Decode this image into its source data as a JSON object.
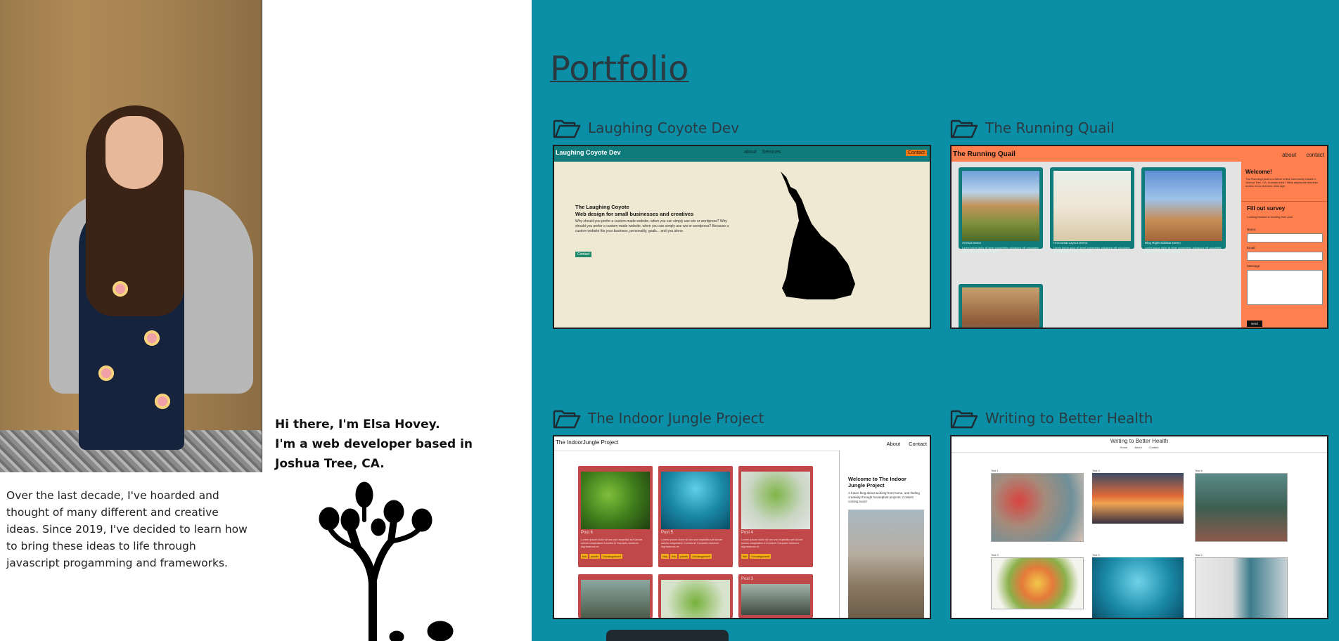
{
  "intro": {
    "greeting": "Hi there, I'm Elsa Hovey.",
    "role": "I'm a web developer based in Joshua Tree, CA.",
    "bio": "Over the last decade, I've hoarded and thought of many different and creative ideas. Since 2019, I've decided to learn how to bring these ideas to life through javascript progamming and frameworks."
  },
  "portfolio": {
    "title": "Portfolio",
    "projects": [
      {
        "title": "Laughing Coyote Dev",
        "shot": {
          "brand": "Laughing Coyote Dev",
          "nav": [
            "about",
            "Services"
          ],
          "cta": "Contact",
          "heading": "The Laughing Coyote",
          "subheading": "Web design for small businesses and creatives",
          "text": "Why should you prefer a custom-made website, when you can simply use wix or wordpress? Why should you prefer a custom-made website, when you can simply use wix or wordpress? Because a custom website fits your business, personality, goals... and you alone.",
          "button": "Contact"
        }
      },
      {
        "title": "The Running Quail",
        "shot": {
          "brand": "The Running Quail",
          "nav": [
            "about",
            "contact"
          ],
          "cards": [
            "Animal Demo",
            "Horizontal Layout Demo",
            "Blog Right Sidebar Demo"
          ],
          "card_text": "Lorem ipsum dolor sit amet consectetur adipiscing elit voluptates saepe incidunt autem commodi.",
          "welcome_title": "Welcome!",
          "welcome_text": "The Running Quail is a future online community based in Joshua Tree, CA. Animals exist? Hilde adipiscate timeless, doxtes recon dolorem vitae agit.",
          "survey_title": "Fill out survey",
          "survey_text": "Looking forward to hearing from you!",
          "labels": [
            "Name:",
            "Email:",
            "Message:"
          ],
          "send": "send"
        }
      },
      {
        "title": "The Indoor Jungle Project",
        "shot": {
          "brand": "The IndoorJungle Project",
          "nav": [
            "About",
            "Contact"
          ],
          "posts": [
            {
              "title": "Post 6",
              "tags": [
                "fish",
                "plants",
                "Uncategorized"
              ]
            },
            {
              "title": "Post 5",
              "tags": [
                "clay",
                "fish",
                "plants",
                "Uncategorized"
              ]
            },
            {
              "title": "Post 4",
              "tags": [
                "fish",
                "Uncategorized"
              ]
            }
          ],
          "post_text": "Lorem ipsum dolor sit am usd expedita set labore soluta voluptatem inventore! Corporis dolorum dignissimos et.",
          "third_row_label": "Post 3",
          "aside_title": "Welcome to The Indoor Jungle Project",
          "aside_text": "A future blog about working from home, and finding creativity through houseplant projects. Content coming soon!"
        }
      },
      {
        "title": "Writing to Better Health",
        "shot": {
          "brand": "Writing to Better Health",
          "nav": [
            "Home",
            "About",
            "Contact"
          ],
          "tiles": [
            "Test 1",
            "Test 4",
            "Test 6",
            "Test 3",
            "Test 5",
            "Test 2"
          ]
        }
      }
    ]
  },
  "icons": {
    "folder": "folder-open-icon",
    "tree": "joshua-tree-icon",
    "wolf": "howling-wolf-icon"
  },
  "colors": {
    "portfolio_bg": "#0a8fa6",
    "title": "#2a3a40",
    "coyote_bar": "#0f7b7a",
    "quail": "#ff7f4f",
    "jungle_card": "#c14848"
  }
}
